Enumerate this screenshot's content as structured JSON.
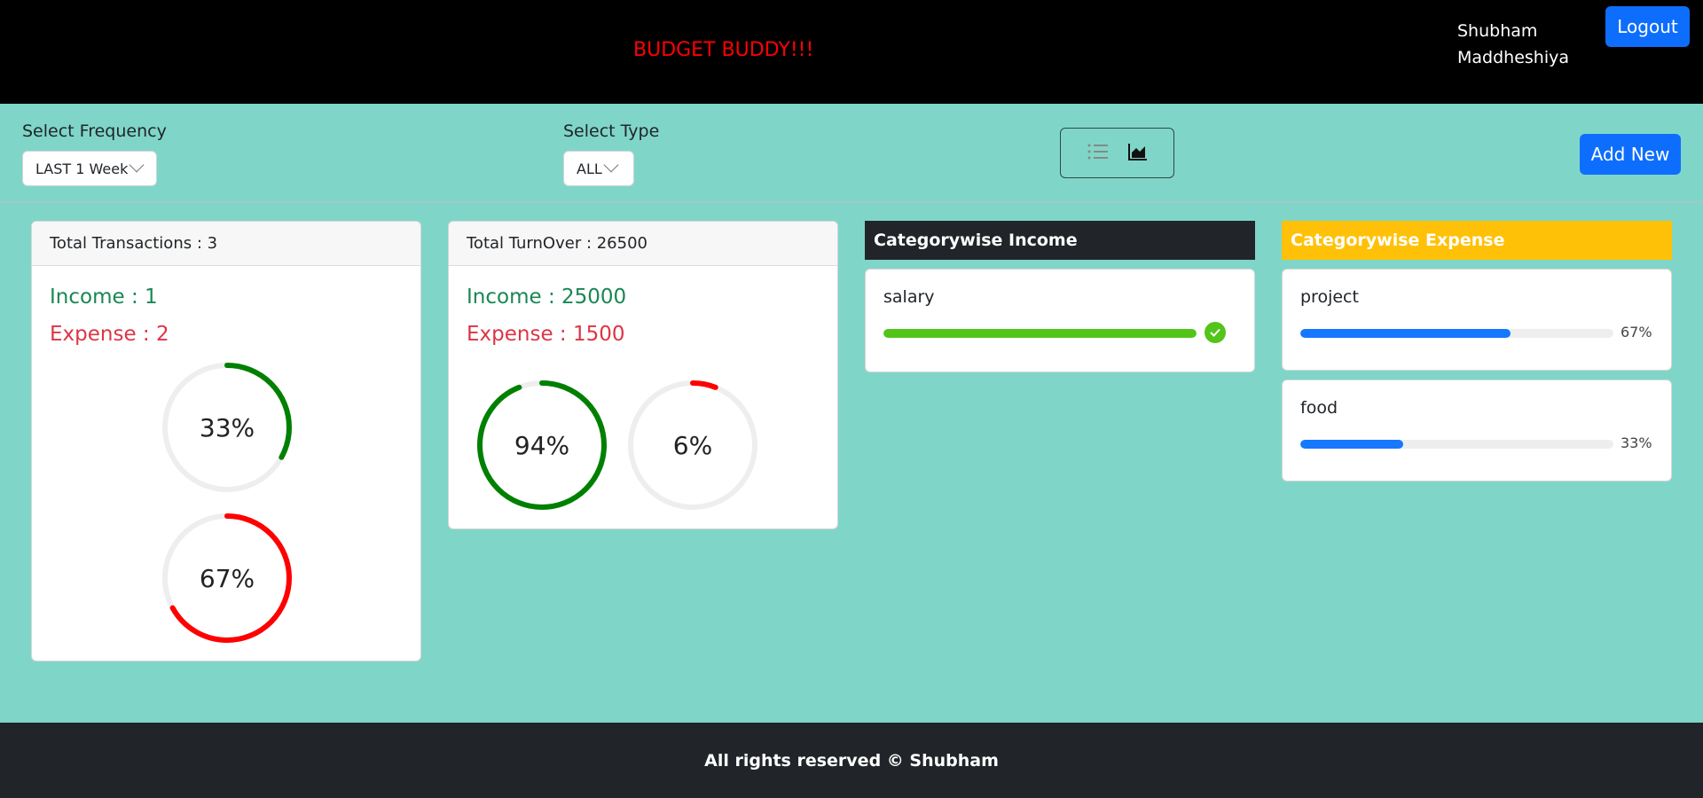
{
  "header": {
    "title": "BUDGET BUDDY!!!",
    "user_name": "Shubham Maddheshiya",
    "logout_label": "Logout"
  },
  "filters": {
    "frequency_label": "Select Frequency",
    "frequency_value": "LAST 1 Week",
    "type_label": "Select Type",
    "type_value": "ALL",
    "view_icons": [
      "list-icon",
      "area-chart-icon"
    ],
    "add_new_label": "Add New"
  },
  "transactions_card": {
    "header": "Total Transactions : 3",
    "income": "Income : 1",
    "expense": "Expense : 2",
    "income_percent": 33,
    "expense_percent": 67,
    "income_percent_label": "33%",
    "expense_percent_label": "67%"
  },
  "turnover_card": {
    "header": "Total TurnOver : 26500",
    "income": "Income : 25000",
    "expense": "Expense : 1500",
    "income_percent": 94,
    "expense_percent": 6,
    "income_percent_label": "94%",
    "expense_percent_label": "6%"
  },
  "categorywise_income": {
    "title": "Categorywise Income",
    "items": [
      {
        "name": "salary",
        "percent": 100,
        "complete": true
      }
    ]
  },
  "categorywise_expense": {
    "title": "Categorywise Expense",
    "items": [
      {
        "name": "project",
        "percent": 67,
        "label": "67%"
      },
      {
        "name": "food",
        "percent": 33,
        "label": "33%"
      }
    ]
  },
  "colors": {
    "income": "#198754",
    "expense": "#dc3545",
    "ring_income": "#008000",
    "ring_expense": "#ff0000",
    "ring_track": "#eeeeee",
    "progress_blue": "#1677ff",
    "progress_green": "#52c41a",
    "income_title_bg": "#212529",
    "expense_title_bg": "#ffc107",
    "page_bg": "#7fd6c8"
  },
  "footer": {
    "text": "All rights reserved © Shubham"
  }
}
